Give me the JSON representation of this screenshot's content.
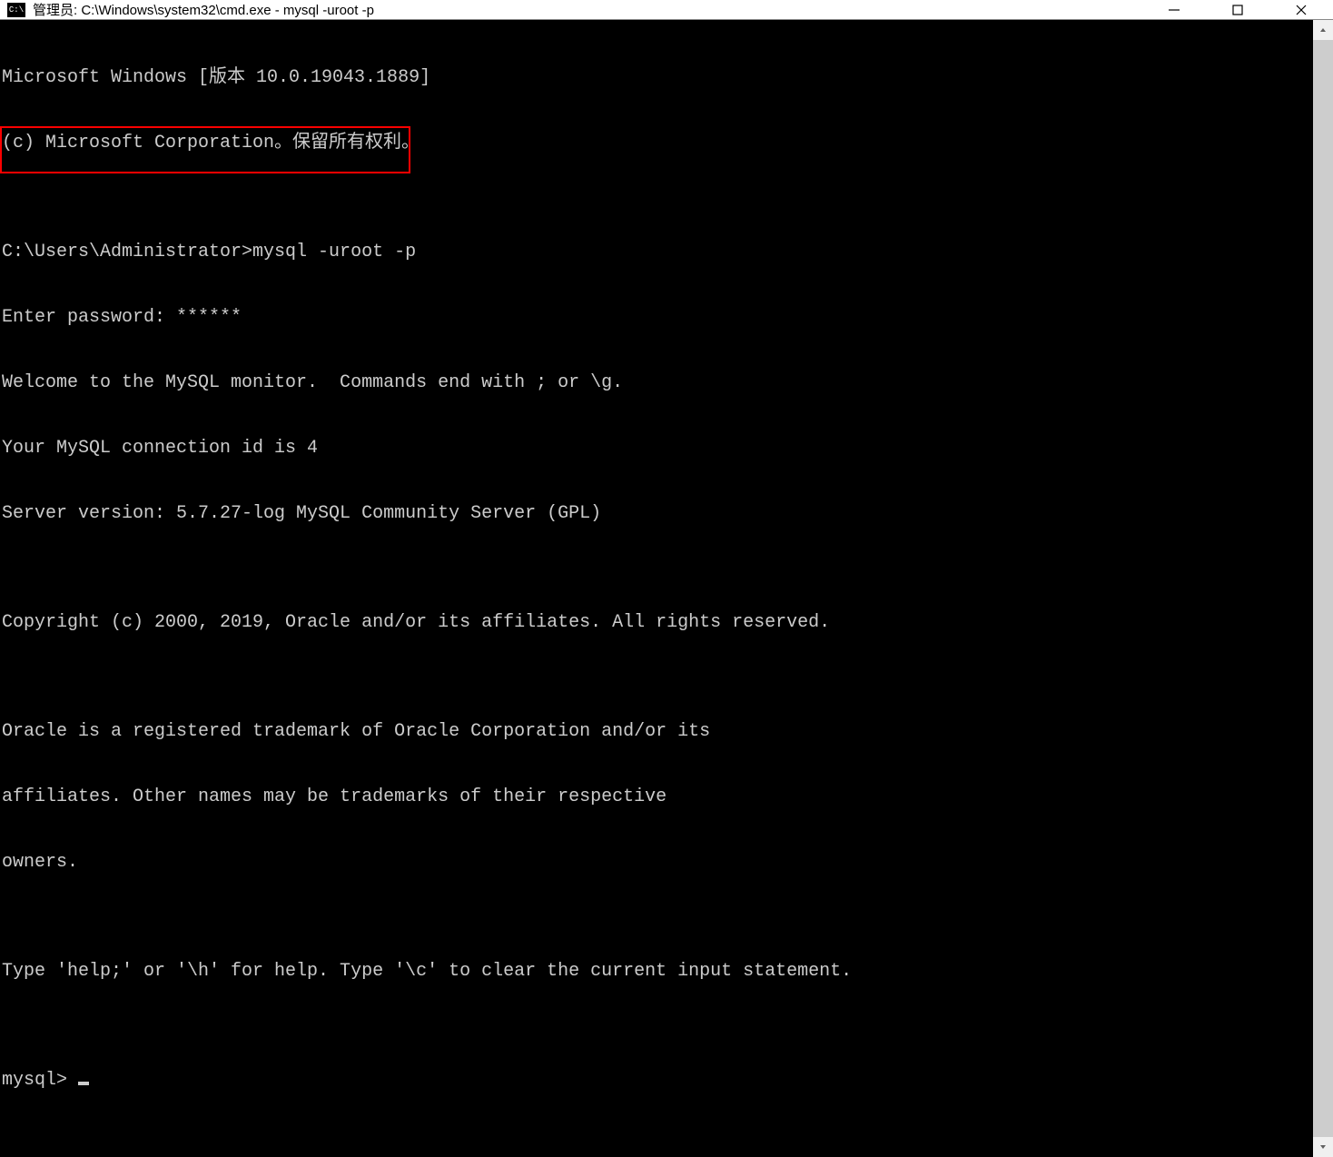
{
  "titlebar": {
    "icon_text": "C:\\",
    "title": "管理员: C:\\Windows\\system32\\cmd.exe - mysql  -uroot -p"
  },
  "terminal": {
    "lines": [
      "Microsoft Windows [版本 10.0.19043.1889]",
      "(c) Microsoft Corporation。保留所有权利。",
      "",
      "C:\\Users\\Administrator>mysql -uroot -p",
      "Enter password: ******",
      "Welcome to the MySQL monitor.  Commands end with ; or \\g.",
      "Your MySQL connection id is 4",
      "Server version: 5.7.27-log MySQL Community Server (GPL)",
      "",
      "Copyright (c) 2000, 2019, Oracle and/or its affiliates. All rights reserved.",
      "",
      "Oracle is a registered trademark of Oracle Corporation and/or its",
      "affiliates. Other names may be trademarks of their respective",
      "owners.",
      "",
      "Type 'help;' or '\\h' for help. Type '\\c' to clear the current input statement.",
      "",
      "mysql> "
    ]
  }
}
